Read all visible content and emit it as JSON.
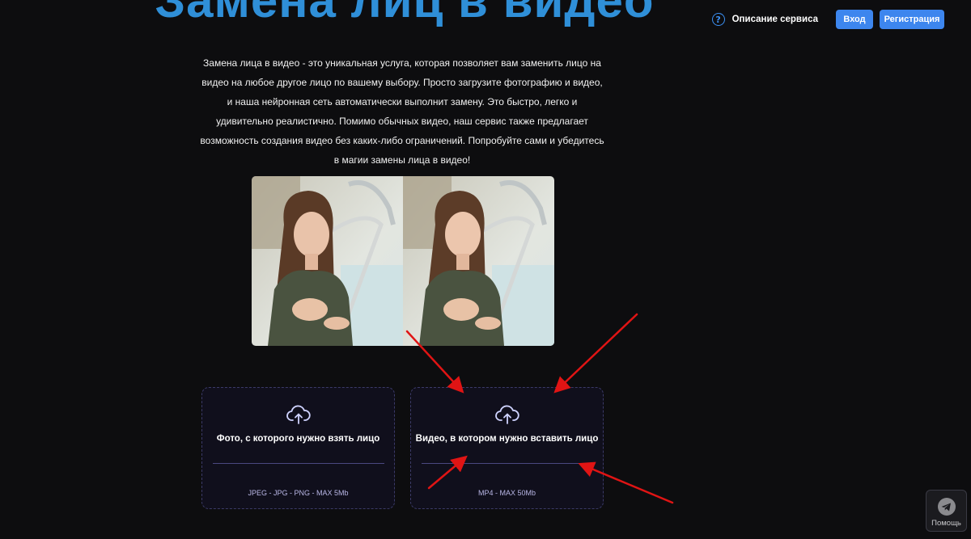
{
  "hero": {
    "title": "Замена лиц в видео",
    "description": "Замена лица в видео - это уникальная услуга, которая позволяет вам заменить лицо на видео на любое другое лицо по вашему выбору. Просто загрузите фотографию и видео, и наша нейронная сеть автоматически выполнит замену. Это быстро, легко и удивительно реалистично. Помимо обычных видео, наш сервис также предлагает возможность создания видео без каких-либо ограничений. Попробуйте сами и убедитесь в магии замены лица в видео!"
  },
  "nav": {
    "help_icon": "question-circle-icon",
    "help_label": "Описание сервиса",
    "login_label": "Вход",
    "register_label": "Регистрация"
  },
  "upload": {
    "photo": {
      "icon": "cloud-upload-icon",
      "title": "Фото, с которого нужно взять лицо",
      "hint": "JPEG - JPG - PNG - MAX 5Mb"
    },
    "video": {
      "icon": "cloud-upload-icon",
      "title": "Видео, в котором нужно вставить лицо",
      "hint": "MP4 - MAX 50Mb"
    }
  },
  "help_widget": {
    "icon": "telegram-icon",
    "label": "Помощь"
  },
  "colors": {
    "background": "#0d0d0f",
    "accent": "#3d86ee",
    "title": "#2f8fd8",
    "card_background": "#100f1c",
    "card_border": "#3b3a68",
    "annotation_arrow": "#e01414"
  }
}
